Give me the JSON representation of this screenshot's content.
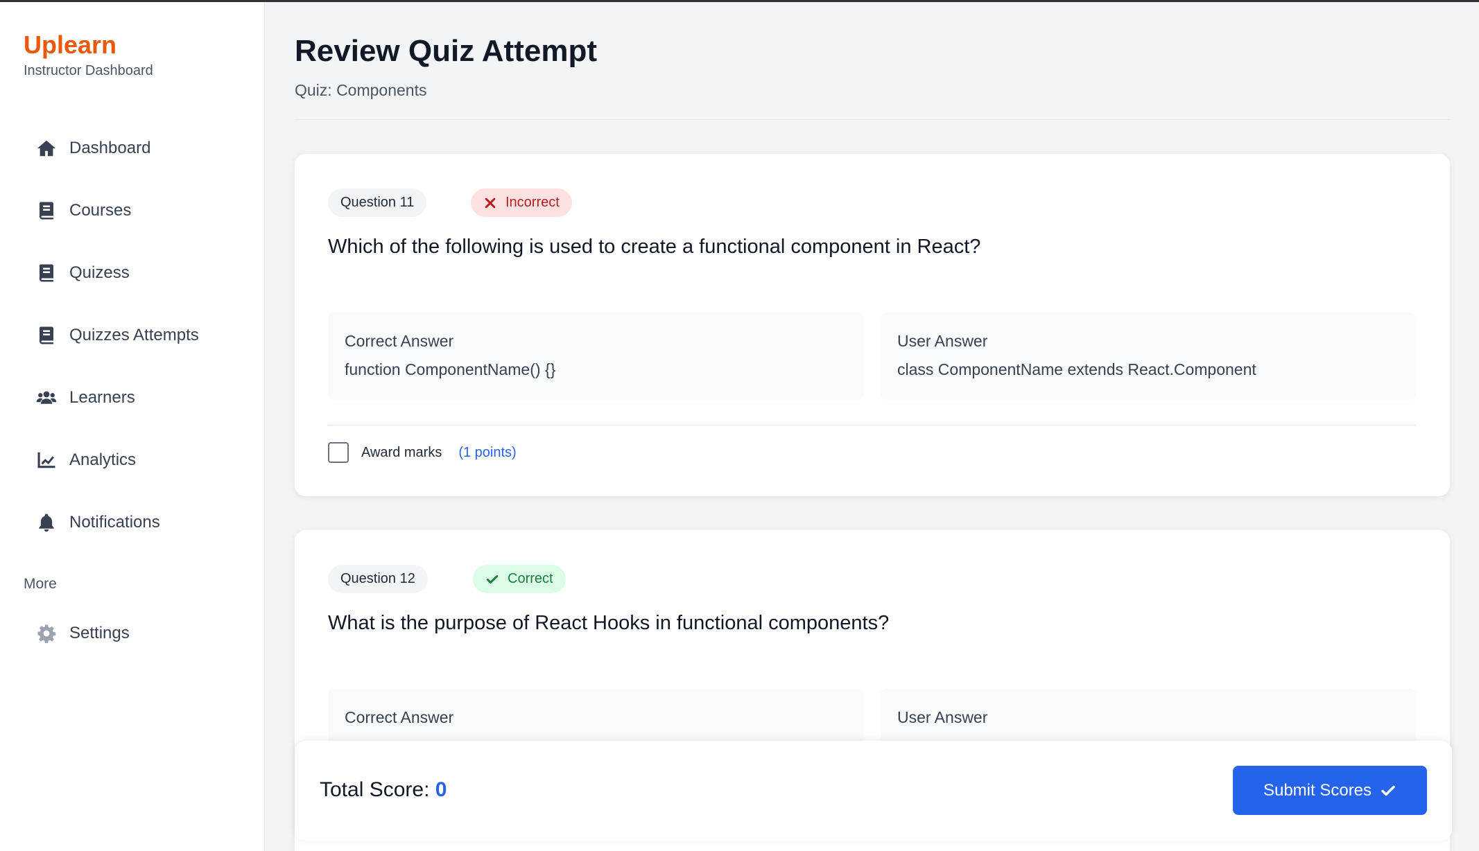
{
  "brand": {
    "name": "Uplearn",
    "subtitle": "Instructor Dashboard"
  },
  "sidebar": {
    "items": [
      {
        "label": "Dashboard",
        "icon": "home-icon"
      },
      {
        "label": "Courses",
        "icon": "book-icon"
      },
      {
        "label": "Quizess",
        "icon": "book-icon"
      },
      {
        "label": "Quizzes Attempts",
        "icon": "book-icon"
      },
      {
        "label": "Learners",
        "icon": "users-icon"
      },
      {
        "label": "Analytics",
        "icon": "chart-line-icon"
      },
      {
        "label": "Notifications",
        "icon": "bell-icon"
      }
    ],
    "section_title": "More",
    "settings": {
      "label": "Settings",
      "icon": "gear-icon"
    }
  },
  "header": {
    "title": "Review Quiz Attempt",
    "subtitle": "Quiz: Components"
  },
  "questions": [
    {
      "number_label": "Question 11",
      "status": "Incorrect",
      "status_color": "#b91c1c",
      "text": "Which of the following is used to create a functional component in React?",
      "correct_label": "Correct Answer",
      "correct_value": "function ComponentName() {}",
      "user_label": "User Answer",
      "user_value": "class ComponentName extends React.Component",
      "award_label": "Award marks",
      "award_points": "(1 points)",
      "award_checked": false
    },
    {
      "number_label": "Question 12",
      "status": "Correct",
      "status_color": "#15803d",
      "text": "What is the purpose of React Hooks in functional components?",
      "correct_label": "Correct Answer",
      "user_label": "User Answer"
    }
  ],
  "footer": {
    "total_label": "Total Score:",
    "total_value": "0",
    "submit_label": "Submit Scores"
  },
  "colors": {
    "brand": "#ea580c",
    "accent": "#2563eb"
  }
}
